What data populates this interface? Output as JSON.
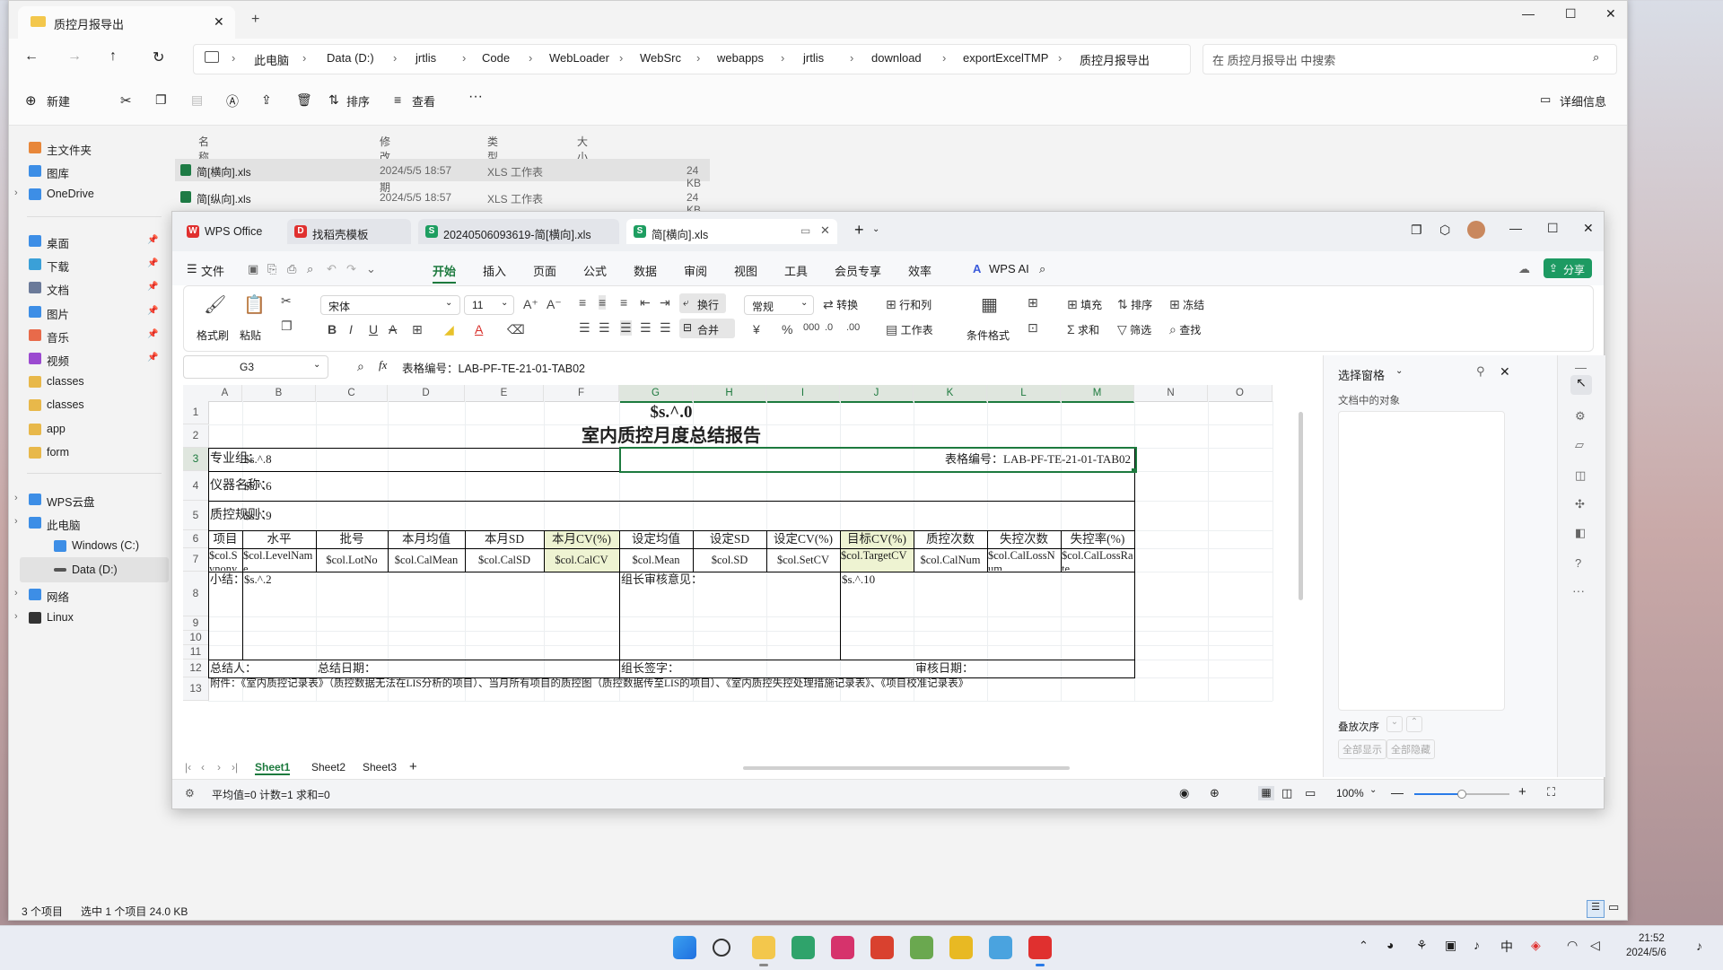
{
  "explorer": {
    "tab_title": "质控月报导出",
    "window_controls": [
      "—",
      "☐",
      "✕"
    ],
    "breadcrumb": [
      "此电脑",
      "Data (D:)",
      "jrtlis",
      "Code",
      "WebLoader",
      "WebSrc",
      "webapps",
      "jrtlis",
      "download",
      "exportExcelTMP",
      "质控月报导出"
    ],
    "search_placeholder": "在 质控月报导出 中搜索",
    "toolbar": {
      "new": "新建",
      "sort": "排序",
      "view": "查看",
      "more": "···",
      "details": "详细信息"
    },
    "sidebar": {
      "home": "主文件夹",
      "gallery": "图库",
      "onedrive": "OneDrive",
      "quick": [
        {
          "label": "桌面",
          "color": "#3d8ee6"
        },
        {
          "label": "下载",
          "color": "#3aa0d8"
        },
        {
          "label": "文档",
          "color": "#6b7a99"
        },
        {
          "label": "图片",
          "color": "#3d8ee6"
        },
        {
          "label": "音乐",
          "color": "#e86a4a"
        },
        {
          "label": "视频",
          "color": "#9b4ad0"
        },
        {
          "label": "classes",
          "color": "#e8b84a"
        },
        {
          "label": "classes",
          "color": "#e8b84a"
        },
        {
          "label": "app",
          "color": "#e8b84a"
        },
        {
          "label": "form",
          "color": "#e8b84a"
        }
      ],
      "wps_cloud": "WPS云盘",
      "this_pc": "此电脑",
      "drive_c": "Windows (C:)",
      "drive_d": "Data (D:)",
      "network": "网络",
      "linux": "Linux"
    },
    "columns": [
      "名称",
      "修改日期",
      "类型",
      "大小"
    ],
    "files": [
      {
        "name": "简[横向].xls",
        "date": "2024/5/5 18:57",
        "type": "XLS 工作表",
        "size": "24 KB",
        "selected": true
      },
      {
        "name": "简[纵向].xls",
        "date": "2024/5/5 18:57",
        "type": "XLS 工作表",
        "size": "24 KB",
        "selected": false
      }
    ],
    "status": {
      "count": "3 个项目",
      "selection": "选中 1 个项目  24.0 KB"
    }
  },
  "wps": {
    "tabs": [
      "WPS Office",
      "找稻壳模板",
      "20240506093619-简[横向].xls",
      "简[横向].xls"
    ],
    "menu_file": "文件",
    "menu": [
      "开始",
      "插入",
      "页面",
      "公式",
      "数据",
      "审阅",
      "视图",
      "工具",
      "会员专享",
      "效率"
    ],
    "wps_ai": "WPS AI",
    "share": "分享",
    "ribbon": {
      "format_painter": "格式刷",
      "paste": "粘贴",
      "font": "宋体",
      "font_size": "11",
      "wrap": "换行",
      "merge": "合并",
      "number_format": "常规",
      "convert": "转换",
      "rows_cols": "行和列",
      "worksheet": "工作表",
      "cond_format": "条件格式",
      "fill": "填充",
      "sort": "排序",
      "freeze": "冻结",
      "sum": "求和",
      "filter": "筛选",
      "find": "查找"
    },
    "name_box": "G3",
    "fx": "fx",
    "formula": "表格编号：LAB-PF-TE-21-01-TAB02",
    "columns": [
      "A",
      "B",
      "C",
      "D",
      "E",
      "F",
      "G",
      "H",
      "I",
      "J",
      "K",
      "L",
      "M",
      "N",
      "O"
    ],
    "rows": [
      "1",
      "2",
      "3",
      "4",
      "5",
      "6",
      "7",
      "8",
      "9",
      "10",
      "11",
      "12",
      "13"
    ],
    "sheet": {
      "r1": "$s.^.0",
      "r2": "室内质控月度总结报告",
      "r3_label": "专业组：",
      "r3_val": "$s.^.8",
      "r3_code": "表格编号：LAB-PF-TE-21-01-TAB02",
      "r4_label": "仪器名称：",
      "r4_val": "$s.^.6",
      "r5_label": "质控规则：",
      "r5_val": "$s.^.9",
      "headers": [
        "项目",
        "水平",
        "批号",
        "本月均值",
        "本月SD",
        "本月CV(%)",
        "设定均值",
        "设定SD",
        "设定CV(%)",
        "目标CV(%)",
        "质控次数",
        "失控次数",
        "失控率(%)"
      ],
      "r7": [
        "$col.Synonym",
        "$col.LevelName",
        "$col.LotNo",
        "$col.CalMean",
        "$col.CalSD",
        "$col.CalCV",
        "$col.Mean",
        "$col.SD",
        "$col.SetCV",
        "$col.TargetCV",
        "$col.CalNum",
        "$col.CalLossNum",
        "$col.CalLossRate"
      ],
      "r8_summary": "小结：",
      "r8_val": "$s.^.2",
      "r8_review": "组长审核意见：",
      "r8_val2": "$s.^.10",
      "r12_person": "总结人：",
      "r12_date": "总结日期：",
      "r12_sign": "组长签字：",
      "r12_review_date": "审核日期：",
      "r13": "附件：《室内质控记录表》（质控数据无法在LIS分析的项目）、当月所有项目的质控图（质控数据传至LIS的项目）、《室内质控失控处理措施记录表》、《项目校准记录表》"
    },
    "sheet_tabs": [
      "Sheet1",
      "Sheet2",
      "Sheet3"
    ],
    "status": {
      "stats": "平均值=0  计数=1  求和=0",
      "zoom": "100%"
    },
    "pane": {
      "title": "选择窗格",
      "objects": "文档中的对象",
      "order": "叠放次序",
      "show_all": "全部显示",
      "hide_all": "全部隐藏"
    }
  },
  "taskbar": {
    "time": "21:52",
    "date": "2024/5/6",
    "apps": [
      {
        "name": "start",
        "color": "#2b7de9"
      },
      {
        "name": "search",
        "color": "#333333"
      },
      {
        "name": "explorer",
        "color": "#f3c74c"
      },
      {
        "name": "edge",
        "color": "#2fa36b"
      },
      {
        "name": "jetbrains",
        "color": "#d6336c"
      },
      {
        "name": "redis",
        "color": "#d9412f"
      },
      {
        "name": "chart",
        "color": "#6aa84f"
      },
      {
        "name": "chrome",
        "color": "#e8b923"
      },
      {
        "name": "photos",
        "color": "#4aa3df"
      },
      {
        "name": "wps",
        "color": "#e0302f"
      }
    ]
  }
}
